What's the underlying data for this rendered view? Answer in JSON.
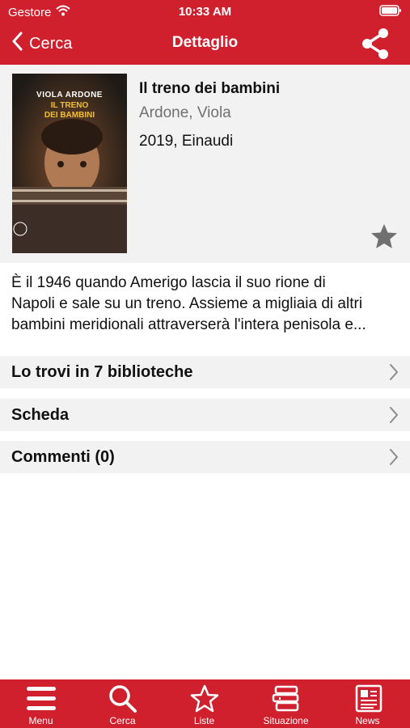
{
  "status_bar": {
    "carrier": "Gestore",
    "time": "10:33 AM"
  },
  "nav": {
    "back_label": "Cerca",
    "title": "Dettaglio"
  },
  "book": {
    "cover_author": "VIOLA ARDONE",
    "cover_title_1": "IL TRENO",
    "cover_title_2": "DEI BAMBINI",
    "title": "Il treno dei bambini",
    "author": "Ardone, Viola",
    "publication": "2019, Einaudi"
  },
  "description": {
    "line1": "È il 1946 quando Amerigo lascia il suo rione di",
    "line2": "Napoli e sale su un treno. Assieme a migliaia di altri",
    "line3": "bambini meridionali attraverserà l'intera penisola e..."
  },
  "rows": {
    "libraries": "Lo trovi in 7 biblioteche",
    "card": "Scheda",
    "comments": "Commenti (0)"
  },
  "tabs": {
    "menu": "Menu",
    "search": "Cerca",
    "lists": "Liste",
    "status": "Situazione",
    "news": "News"
  },
  "colors": {
    "brand_red": "#d0202e",
    "row_bg": "#f2f2f2",
    "muted_text": "#707070"
  }
}
